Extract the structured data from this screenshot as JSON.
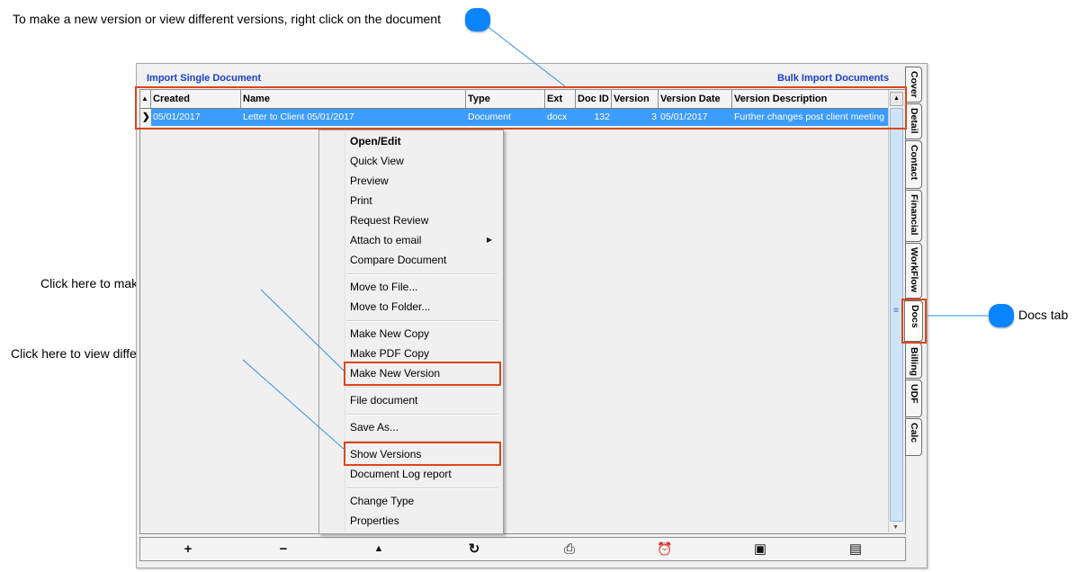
{
  "callouts": {
    "top": "To make a new version or view different versions, right click on the document",
    "new_version": "Click here to make a new version",
    "view_versions": "Click here to view different versions",
    "docs_tab": "Docs tab"
  },
  "links": {
    "import_single": "Import Single Document",
    "bulk_import": "Bulk Import Documents"
  },
  "table": {
    "sort_indicator": "▲",
    "columns": [
      "Created",
      "Name",
      "Type",
      "Ext",
      "Doc ID",
      "Version",
      "Version Date",
      "Version Description"
    ],
    "rows": [
      {
        "selector": "❯",
        "created": "05/01/2017",
        "name": "Letter to Client 05/01/2017",
        "type": "Document",
        "ext": "docx",
        "doc_id": "132",
        "version": "3",
        "version_date": "05/01/2017",
        "version_description": "Further changes post client meeting"
      }
    ]
  },
  "menu": {
    "items": [
      "Open/Edit",
      "Quick View",
      "Preview",
      "Print",
      "Request Review",
      "Attach to email",
      "Compare Document",
      "Move to File...",
      "Move to Folder...",
      "Make New Copy",
      "Make PDF Copy",
      "Make New Version",
      "File document",
      "Save As...",
      "Show Versions",
      "Document Log report",
      "Change Type",
      "Properties"
    ],
    "submenu_arrow": "▶"
  },
  "tabs": [
    "Cover",
    "Detail",
    "Contact",
    "Financial",
    "WorkFlow",
    "Docs",
    "Billing",
    "UDF",
    "Calc"
  ],
  "active_tab": "Docs",
  "toolbar": {
    "icons": [
      "plus-icon",
      "minus-icon",
      "up-arrow-icon",
      "refresh-icon",
      "printer-icon",
      "alarm-clock-icon",
      "image-icon",
      "list-icon"
    ],
    "glyphs": [
      "+",
      "−",
      "▲",
      "↻",
      "⎙",
      "⏰",
      "▣",
      "▤"
    ]
  },
  "scrollbar": {
    "up": "▲",
    "down": "▼",
    "grip": "≡"
  },
  "colors": {
    "selection": "#3c9cff",
    "highlight_border": "#d9471b",
    "callout_bubble": "#0a84ff",
    "link": "#1a3fd0"
  }
}
